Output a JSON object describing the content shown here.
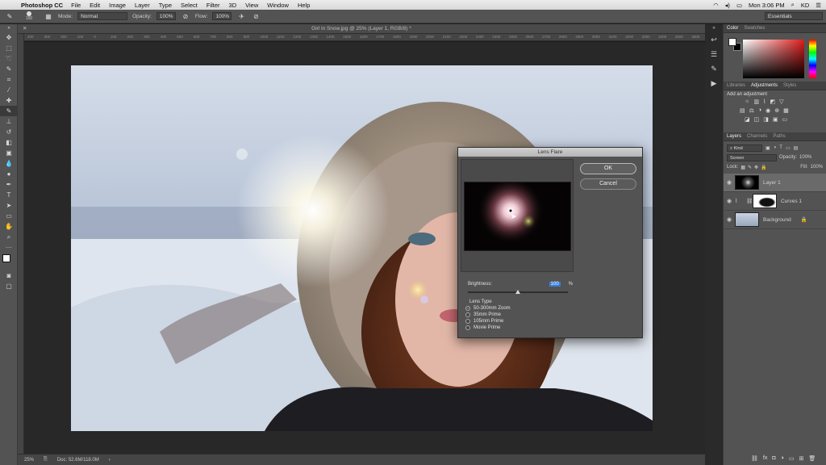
{
  "menubar": {
    "app_name": "Photoshop CC",
    "items": [
      "File",
      "Edit",
      "Image",
      "Layer",
      "Type",
      "Select",
      "Filter",
      "3D",
      "View",
      "Window",
      "Help"
    ],
    "clock": "Mon 3:06 PM",
    "user": "KD"
  },
  "options_bar": {
    "brush_size": "150",
    "mode_label": "Mode:",
    "mode_value": "Normal",
    "opacity_label": "Opacity:",
    "opacity_value": "100%",
    "flow_label": "Flow:",
    "flow_value": "100%",
    "workspace": "Essentials"
  },
  "document": {
    "tab_title": "Girl in Snow.jpg @ 25% (Layer 1, RGB/8) *",
    "ruler_ticks": [
      "400",
      "300",
      "200",
      "100",
      "0",
      "100",
      "200",
      "300",
      "400",
      "500",
      "600",
      "700",
      "800",
      "900",
      "1000",
      "1100",
      "1200",
      "1300",
      "1400",
      "1500",
      "1600",
      "1700",
      "1800",
      "1900",
      "2000",
      "2100",
      "2200",
      "2300",
      "2400",
      "2500",
      "2600",
      "2700",
      "2800",
      "2900",
      "3000",
      "3100",
      "3200",
      "3300",
      "3400",
      "3500",
      "3600"
    ],
    "zoom": "25%",
    "doc_size": "Doc: 52.6M/118.0M"
  },
  "color_panel": {
    "tabs": [
      "Color",
      "Swatches"
    ],
    "active_tab": "Color"
  },
  "adjustments_panel": {
    "tabs": [
      "Libraries",
      "Adjustments",
      "Styles"
    ],
    "active_tab": "Adjustments",
    "heading": "Add an adjustment"
  },
  "layers_panel": {
    "tabs": [
      "Layers",
      "Channels",
      "Paths"
    ],
    "active_tab": "Layers",
    "filter_kind": "Kind",
    "blend_mode": "Screen",
    "opacity_label": "Opacity:",
    "opacity_value": "100%",
    "lock_label": "Lock:",
    "fill_label": "Fill:",
    "fill_value": "100%",
    "layers": [
      {
        "name": "Layer 1",
        "selected": true
      },
      {
        "name": "Curves 1",
        "selected": false
      },
      {
        "name": "Background",
        "selected": false
      }
    ]
  },
  "lens_flare_dialog": {
    "title": "Lens Flare",
    "ok_label": "OK",
    "cancel_label": "Cancel",
    "brightness_label": "Brightness:",
    "brightness_value": "100",
    "brightness_unit": "%",
    "brightness_level": 0.5,
    "lens_type_label": "Lens Type",
    "lens_types": [
      "50-300mm Zoom",
      "35mm Prime",
      "105mm Prime",
      "Movie Prime"
    ],
    "selected_lens": "50-300mm Zoom"
  },
  "colors": {
    "accent": "#3b7cd6",
    "panel_bg": "#535353",
    "canvas_bg": "#282828"
  }
}
